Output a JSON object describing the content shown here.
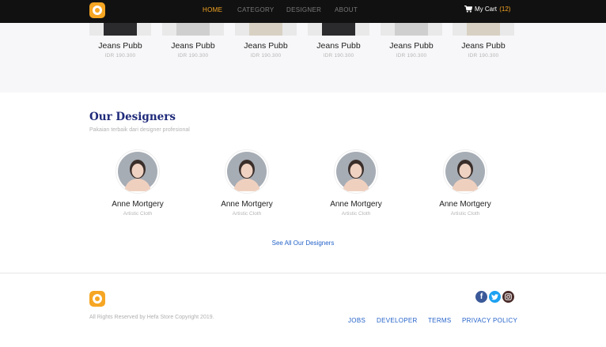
{
  "nav": {
    "items": [
      {
        "label": "HOME",
        "active": true
      },
      {
        "label": "CATEGORY",
        "active": false
      },
      {
        "label": "DESIGNER",
        "active": false
      },
      {
        "label": "ABOUT",
        "active": false
      }
    ],
    "cart_label": "My Cart",
    "cart_count": "(12)"
  },
  "products": [
    {
      "name": "Jeans Pubb",
      "price": "IDR 190.300",
      "image": "dark"
    },
    {
      "name": "Jeans Pubb",
      "price": "IDR 190.300",
      "image": "light"
    },
    {
      "name": "Jeans Pubb",
      "price": "IDR 190.300",
      "image": "beige"
    },
    {
      "name": "Jeans Pubb",
      "price": "IDR 190.300",
      "image": "dark"
    },
    {
      "name": "Jeans Pubb",
      "price": "IDR 190.300",
      "image": "light"
    },
    {
      "name": "Jeans Pubb",
      "price": "IDR 190.300",
      "image": "beige"
    }
  ],
  "designers": {
    "title": "Our Designers",
    "subtitle": "Pakaian terbaik dari designer profesional",
    "items": [
      {
        "name": "Anne Mortgery",
        "role": "Artistic Cloth"
      },
      {
        "name": "Anne Mortgery",
        "role": "Artistic Cloth"
      },
      {
        "name": "Anne Mortgery",
        "role": "Artistic Cloth"
      },
      {
        "name": "Anne Mortgery",
        "role": "Artistic Cloth"
      }
    ],
    "see_all": "See All Our Designers"
  },
  "footer": {
    "copyright": "All Rights Reserved by Hefa Store Copyright 2019.",
    "links": [
      "JOBS",
      "DEVELOPER",
      "TERMS",
      "PRIVACY POLICY"
    ],
    "social": [
      "facebook-icon",
      "twitter-icon",
      "instagram-icon"
    ]
  },
  "colors": {
    "accent": "#f6a623",
    "navbar": "#111111",
    "link": "#2563c9",
    "heading": "#1f2a7a"
  }
}
